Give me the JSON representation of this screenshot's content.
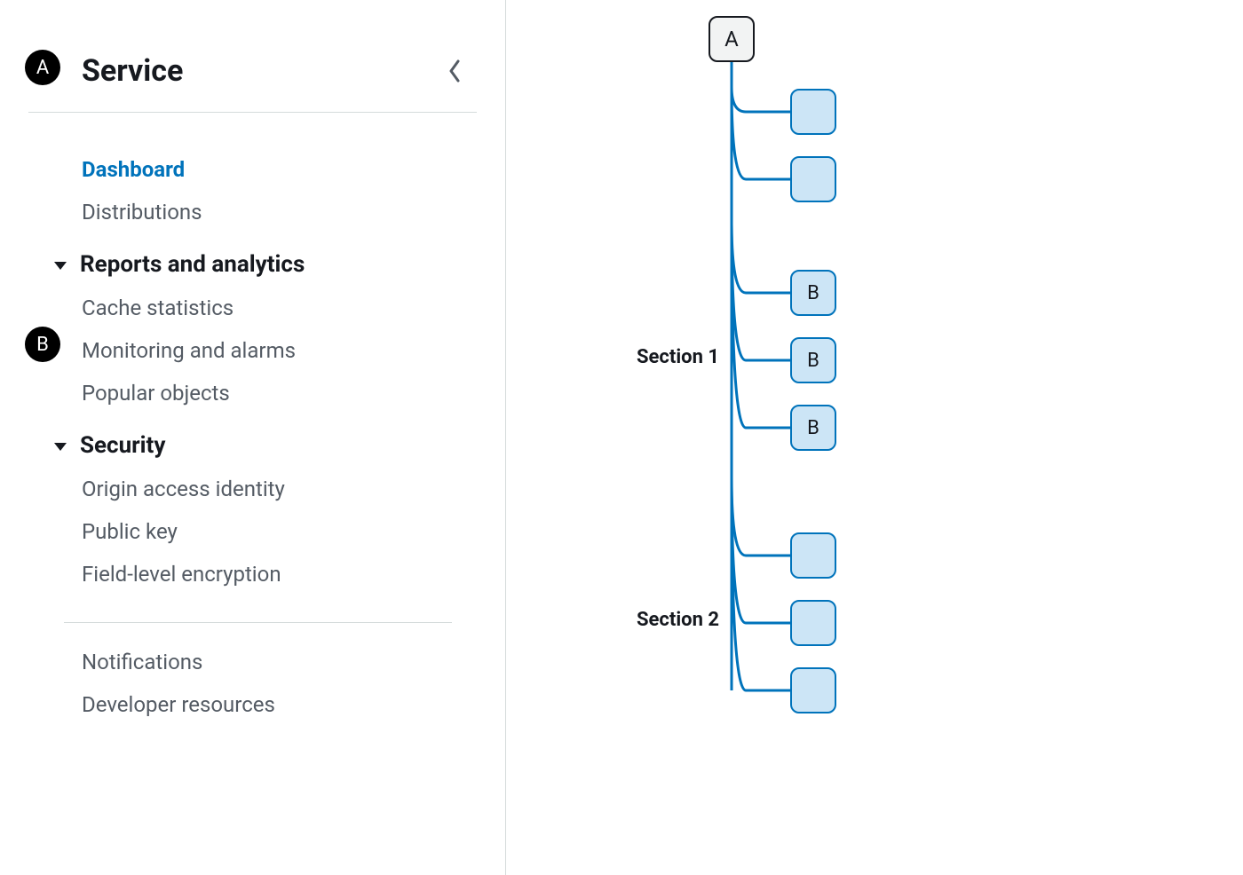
{
  "badges": {
    "a": "A",
    "b": "B"
  },
  "sidebar": {
    "title": "Service",
    "root_links": [
      {
        "label": "Dashboard",
        "active": true
      },
      {
        "label": "Distributions",
        "active": false
      }
    ],
    "sections": [
      {
        "title": "Reports and analytics",
        "items": [
          {
            "label": "Cache statistics"
          },
          {
            "label": "Monitoring and alarms"
          },
          {
            "label": "Popular objects"
          }
        ]
      },
      {
        "title": "Security",
        "items": [
          {
            "label": "Origin access identity"
          },
          {
            "label": "Public key"
          },
          {
            "label": "Field-level encryption"
          }
        ]
      }
    ],
    "footer_links": [
      {
        "label": "Notifications"
      },
      {
        "label": "Developer resources"
      }
    ]
  },
  "diagram": {
    "root_label": "A",
    "section1_label": "Section 1",
    "section2_label": "Section 2",
    "groups": [
      {
        "labels": [
          "",
          ""
        ]
      },
      {
        "labels": [
          "B",
          "B",
          "B"
        ]
      },
      {
        "labels": [
          "",
          "",
          ""
        ]
      }
    ]
  }
}
